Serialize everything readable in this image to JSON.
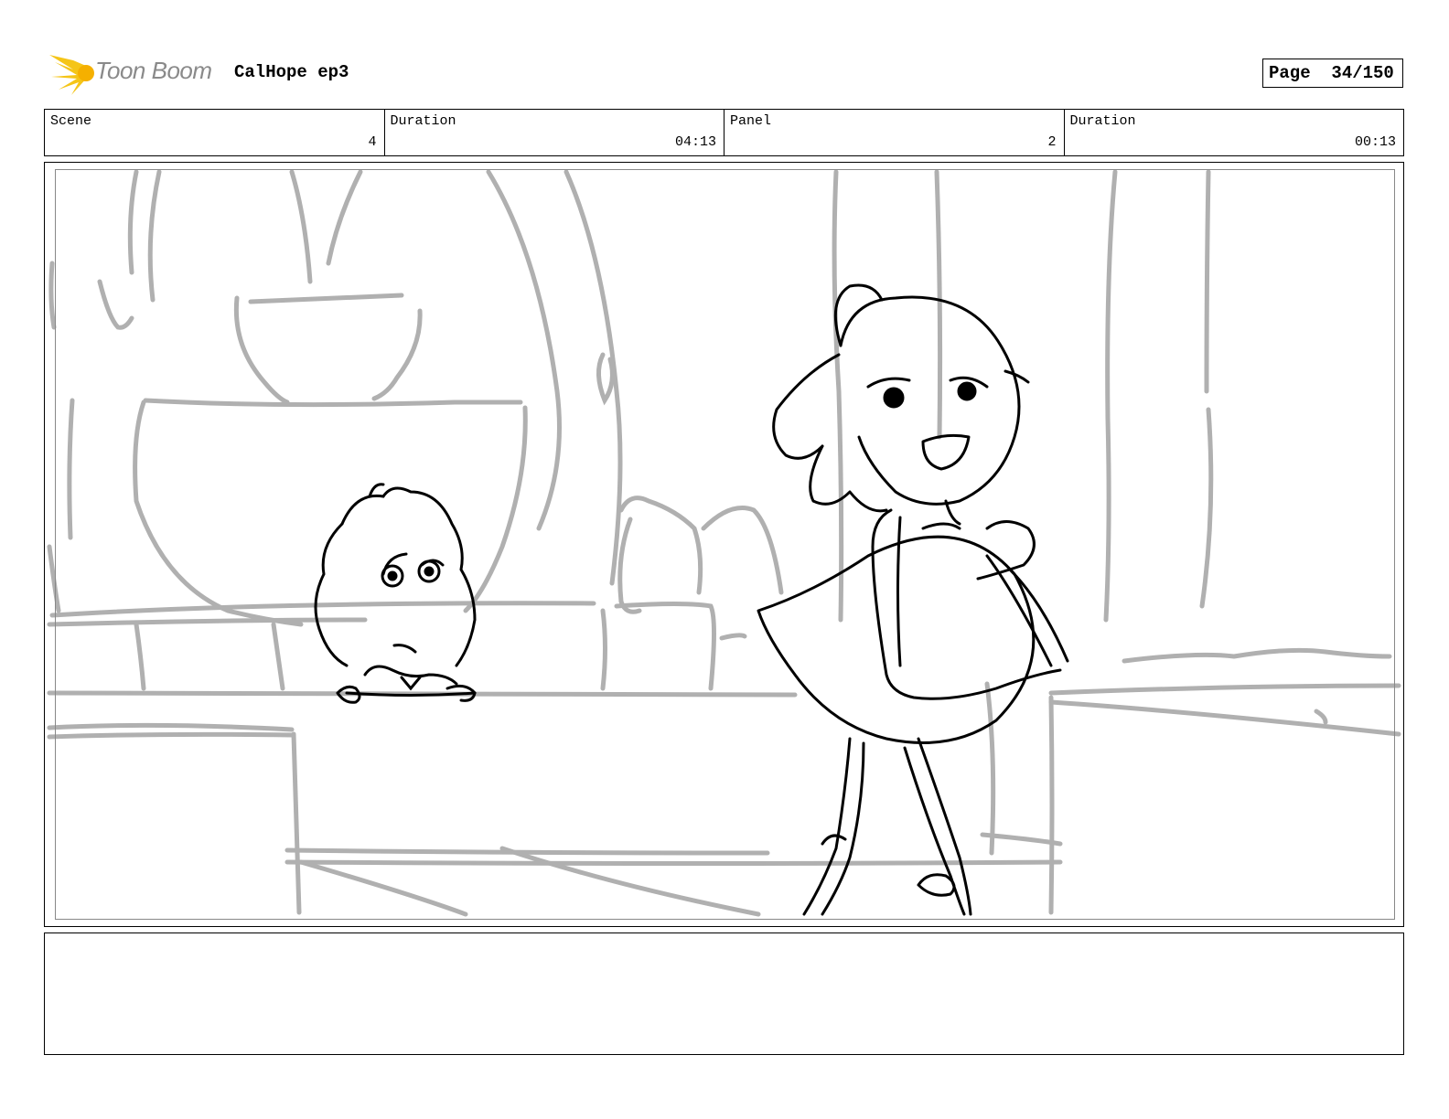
{
  "header": {
    "logo_text": "Toon Boom",
    "project_title": "CalHope ep3",
    "page_label": "Page",
    "page_number": "34/150"
  },
  "info": {
    "scene_label": "Scene",
    "scene_value": "4",
    "scene_duration_label": "Duration",
    "scene_duration_value": "04:13",
    "panel_label": "Panel",
    "panel_value": "2",
    "panel_duration_label": "Duration",
    "panel_duration_value": "00:13"
  },
  "notes": {
    "text": ""
  },
  "colors": {
    "logo_accent": "#f5c518",
    "logo_text": "#8a8a8a",
    "background_sketch": "#b0b0b0",
    "character_line": "#000000"
  }
}
